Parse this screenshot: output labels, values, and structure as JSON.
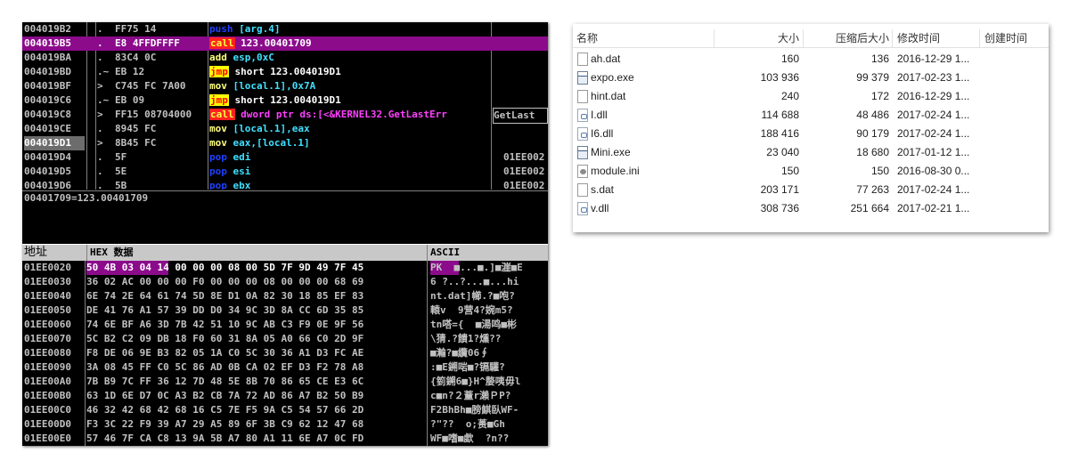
{
  "disasm": {
    "rows": [
      {
        "addr": "004019B2",
        "mark": ".",
        "hex": "FF75 14",
        "mn": "push",
        "op": "[arg.4]",
        "cmt": ""
      },
      {
        "addr": "004019B5",
        "mark": ".",
        "hex": "E8 4FFDFFFF",
        "mn": "call",
        "op": "123.00401709",
        "cmt": ""
      },
      {
        "addr": "004019BA",
        "mark": ".",
        "hex": "83C4 0C",
        "mn": "add",
        "op": "esp,0xC",
        "cmt": ""
      },
      {
        "addr": "004019BD",
        "mark": ".~",
        "hex": "EB 12",
        "mn": "jmp",
        "op": "short 123.004019D1",
        "cmt": ""
      },
      {
        "addr": "004019BF",
        "mark": ">",
        "hex": "C745 FC 7A00",
        "mn": "mov",
        "op": "[local.1],0x7A",
        "cmt": ""
      },
      {
        "addr": "004019C6",
        "mark": ".~",
        "hex": "EB 09",
        "mn": "jmp",
        "op": "short 123.004019D1",
        "cmt": ""
      },
      {
        "addr": "004019C8",
        "mark": ">",
        "hex": "FF15 08704000",
        "mn": "call",
        "op": "dword ptr ds:[<&KERNEL32.GetLastErr",
        "cmt": "GetLast"
      },
      {
        "addr": "004019CE",
        "mark": ".",
        "hex": "8945 FC",
        "mn": "mov",
        "op": "[local.1],eax",
        "cmt": ""
      },
      {
        "addr": "004019D1",
        "mark": ">",
        "hex": "8B45 FC",
        "mn": "mov",
        "op": "eax,[local.1]",
        "cmt": ""
      },
      {
        "addr": "004019D4",
        "mark": ".",
        "hex": "5F",
        "mn": "pop",
        "op": "edi",
        "cmt": "01EE002"
      },
      {
        "addr": "004019D5",
        "mark": ".",
        "hex": "5E",
        "mn": "pop",
        "op": "esi",
        "cmt": "01EE002"
      },
      {
        "addr": "004019D6",
        "mark": ".",
        "hex": "5B",
        "mn": "pop",
        "op": "ebx",
        "cmt": "01EE002"
      }
    ],
    "info_line": "00401709=123.00401709"
  },
  "dump": {
    "header_address": "地址",
    "header_hex": "HEX 数据",
    "header_ascii": "ASCII",
    "rows": [
      {
        "addr": "01EE0020",
        "hex": "50 4B 03 04 14 00 00 00 08 00 5D 7F 9D 49 7F 45",
        "ascii": "PK  ■...■.]■漄■E"
      },
      {
        "addr": "01EE0030",
        "hex": "36 02 AC 00 00 00 F0 00 00 00 08 00 00 00 68 69",
        "ascii": "6 ̄?..?...■...hi"
      },
      {
        "addr": "01EE0040",
        "hex": "6E 74 2E 64 61 74 5D 8E D1 0A 82 30 18 85 EF 83",
        "ascii": "nt.dat]幯.?■咆?"
      },
      {
        "addr": "01EE0050",
        "hex": "DE 41 76 A1 57 39 DD D0 34 9C 3D 8A CC 6D 35 85",
        "ascii": "轅v  9营4?婉m5?"
      },
      {
        "addr": "01EE0060",
        "hex": "74 6E BF A6 3D 7B 42 51 10 9C AB C3 F9 0E 9F 56",
        "ascii": "tn嗒={  ■湯鸣■彬"
      },
      {
        "addr": "01EE0070",
        "hex": "5C B2 C2 09 DB 18 F0 60 31 8A 05 A0 66 C0 2D 9F",
        "ascii": "\\猜.?饋1?燻??"
      },
      {
        "addr": "01EE0080",
        "hex": "F8 DE 06 9E B3 82 05 1A C0 5C 30 36 A1 D3 FC AE",
        "ascii": "■瀭?■纜06∮"
      },
      {
        "addr": "01EE0090",
        "hex": "3A 08 45 FF C0 5C 86 AD 0B CA 02 EF D3 F2 78 A8",
        "ascii": ":■E鎙啱■?镉驩?"
      },
      {
        "addr": "01EE00A0",
        "hex": "7B B9 7C FF 36 12 7D 48 5E 8B 70 86 65 CE E3 6C",
        "ascii": "{箌鎙6■}H^嫠咦毋l"
      },
      {
        "addr": "01EE00B0",
        "hex": "63 1D 6E D7 0C A3 B2 CB 7A 72 AD 86 A7 B2 50 B9",
        "ascii": "c■n?２蕫r瀨ＰP?"
      },
      {
        "addr": "01EE00C0",
        "hex": "46 32 42 68 42 68 16 C5 7E F5 9A C5 54 57 66 2D",
        "ascii": "F2BhBh■膀鯕臥WF-"
      },
      {
        "addr": "01EE00D0",
        "hex": "F3 3C 22 F9 39 A7 29 A5 89 6F 3B C9 62 12 47 68",
        "ascii": "?\"??  o;蒉■Gh"
      },
      {
        "addr": "01EE00E0",
        "hex": "57 46 7F CA C8 13 9A 5B A7 80 A1 11 6E A7 0C FD",
        "ascii": "WF■嗜■歔  ?n??"
      }
    ]
  },
  "explorer": {
    "columns": {
      "name": "名称",
      "size": "大小",
      "compressed": "压缩后大小",
      "modified": "修改时间",
      "created": "创建时间"
    },
    "files": [
      {
        "name": "ah.dat",
        "icon": "file-icon",
        "size": "160",
        "compressed": "136",
        "modified": "2016-12-29 1..."
      },
      {
        "name": "expo.exe",
        "icon": "exe-icon",
        "size": "103 936",
        "compressed": "99 379",
        "modified": "2017-02-23 1..."
      },
      {
        "name": "hint.dat",
        "icon": "file-icon",
        "size": "240",
        "compressed": "172",
        "modified": "2016-12-29 1..."
      },
      {
        "name": "I.dll",
        "icon": "dll-icon",
        "size": "114 688",
        "compressed": "48 486",
        "modified": "2017-02-24 1..."
      },
      {
        "name": "I6.dll",
        "icon": "dll-icon",
        "size": "188 416",
        "compressed": "90 179",
        "modified": "2017-02-24 1..."
      },
      {
        "name": "Mini.exe",
        "icon": "exe-icon",
        "size": "23 040",
        "compressed": "18 680",
        "modified": "2017-01-12 1..."
      },
      {
        "name": "module.ini",
        "icon": "ini-icon",
        "size": "150",
        "compressed": "150",
        "modified": "2016-08-30 0..."
      },
      {
        "name": "s.dat",
        "icon": "file-icon",
        "size": "203 171",
        "compressed": "77 263",
        "modified": "2017-02-24 1..."
      },
      {
        "name": "v.dll",
        "icon": "dll-icon",
        "size": "308 736",
        "compressed": "251 664",
        "modified": "2017-02-21 1..."
      }
    ]
  }
}
